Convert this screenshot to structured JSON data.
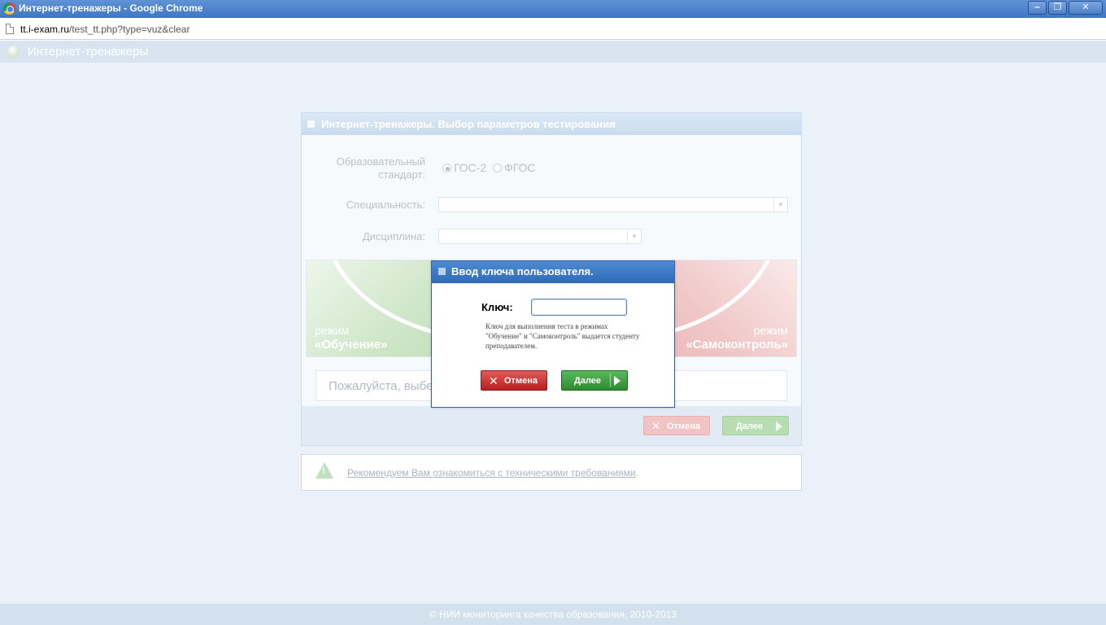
{
  "window": {
    "title": "Интернет-тренажеры - Google Chrome",
    "minimize_label": "‒",
    "maximize_label": "❐",
    "close_label": "✕"
  },
  "address_bar": {
    "host": "tt.i-exam.ru",
    "path": "/test_tt.php?type=vuz&clear"
  },
  "site": {
    "title": "Интернет-тренажеры",
    "footer": "© НИИ мониторинга качества образования, 2010-2013"
  },
  "panel": {
    "title": "Интернет-тренажеры. Выбор параметров тестирования",
    "standard_label_line1": "Образовательный",
    "standard_label_line2": "стандарт:",
    "standard_options": [
      "ГОС-2",
      "ФГОС"
    ],
    "standard_selected": "ГОС-2",
    "specialty_label": "Специальность:",
    "discipline_label": "Дисциплина:",
    "mode_learn_line1": "режим",
    "mode_learn_line2": "«Обучение»",
    "mode_self_line1": "режим",
    "mode_self_line2": "«Самоконтроль»",
    "hint": "Пожалуйста, выбер",
    "cancel_label": "Отмена",
    "next_label": "Далее"
  },
  "recommendation": {
    "link_text": "Рекомендуем Вам ознакомиться с техническими требованиями",
    "suffix": "."
  },
  "dialog": {
    "title": "Ввод ключа пользователя.",
    "key_label": "Ключ:",
    "key_value": "",
    "note": "Ключ для выполнения теста в режимах \"Обучение\" и \"Самоконтроль\" выдается студенту преподавателем.",
    "cancel_label": "Отмена",
    "next_label": "Далее"
  },
  "colors": {
    "titlebar": "#3f76c4",
    "dialog_header": "#2f6ab8",
    "cancel_red": "#b82020",
    "next_green": "#2e8a2e",
    "page_bg": "#eaf1f8"
  }
}
